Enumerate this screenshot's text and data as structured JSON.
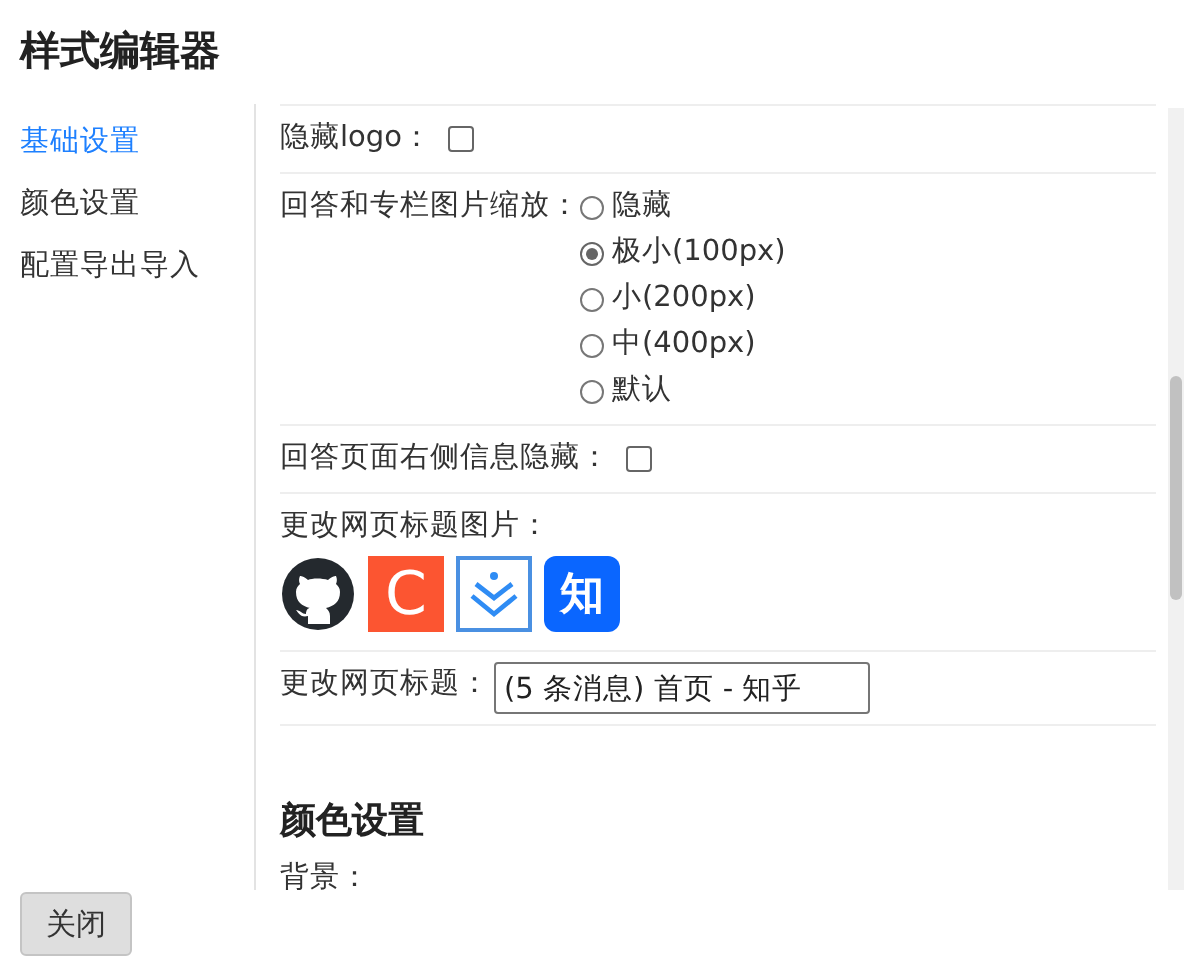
{
  "window": {
    "title": "样式编辑器"
  },
  "sidebar": {
    "items": [
      {
        "label": "基础设置",
        "selected": true
      },
      {
        "label": "颜色设置",
        "selected": false
      },
      {
        "label": "配置导出导入",
        "selected": false
      }
    ]
  },
  "settings": [
    {
      "kind": "checkbox",
      "label": "隐藏logo：",
      "checked": false
    },
    {
      "kind": "radio",
      "label": "回答和专栏图片缩放：",
      "options": [
        {
          "label": "隐藏",
          "selected": false
        },
        {
          "label": "极小(100px)",
          "selected": true
        },
        {
          "label": "小(200px)",
          "selected": false
        },
        {
          "label": "中(400px)",
          "selected": false
        },
        {
          "label": "默认",
          "selected": false
        }
      ]
    },
    {
      "kind": "checkbox",
      "label": "回答页面右侧信息隐藏：",
      "checked": false
    },
    {
      "kind": "icons",
      "label": "更改网页标题图片：",
      "icons": [
        {
          "kind": "cat",
          "selected": false
        },
        {
          "kind": "letter",
          "text": "C",
          "selected": false
        },
        {
          "kind": "chevrons",
          "selected": true
        },
        {
          "kind": "badge",
          "text": "知",
          "selected": false
        }
      ]
    },
    {
      "kind": "text",
      "label": "更改网页标题：",
      "value": "(5 条消息) 首页 - 知乎"
    }
  ],
  "color_section": {
    "heading": "颜色设置",
    "fields": [
      "背景："
    ]
  },
  "buttons": [
    {
      "label": "关闭"
    }
  ]
}
